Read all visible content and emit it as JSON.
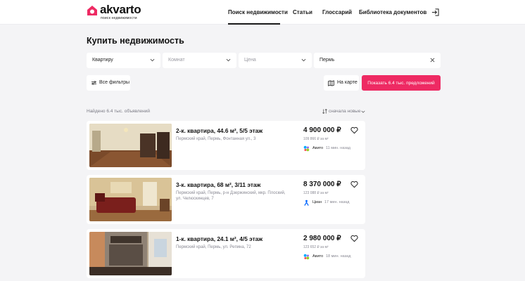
{
  "brand": {
    "name": "akvarto",
    "tagline": "поиск недвижимости",
    "accent": "#ee2a63"
  },
  "nav": {
    "items": [
      {
        "label": "Поиск недвижимости",
        "active": true
      },
      {
        "label": "Статьи",
        "active": false
      },
      {
        "label": "Глоссарий",
        "active": false
      },
      {
        "label": "Библиотека документов",
        "active": false
      }
    ],
    "login_icon": "login-icon"
  },
  "page": {
    "title": "Купить недвижимость"
  },
  "filters": {
    "type": {
      "value": "Квартиру"
    },
    "rooms": {
      "placeholder": "Комнат"
    },
    "price": {
      "placeholder": "Цена"
    },
    "city": {
      "value": "Пермь"
    },
    "all_filters_label": "Все фильтры",
    "map_label": "На карте",
    "show_label": "Показать 6.4 тыс. предложений"
  },
  "results": {
    "found_text": "Найдено 6.4 тыс. объявлений",
    "sort_label": "сначала новые"
  },
  "listings": [
    {
      "title": "2-к. квартира, 44.6 м², 5/5 этаж",
      "address": "Пермский край, Пермь, Фонтанная ул., 3",
      "price": "4 900 000 ₽",
      "price_per_m2": "109 866 ₽ за м²",
      "source": "Авито",
      "time": "11 мин. назад",
      "source_icon": "avito-logo-icon"
    },
    {
      "title": "3-к. квартира, 68 м², 3/11 этаж",
      "address": "Пермский край, Пермь, р-н Дзержинский, мкр. Плоский, ул. Челюскинцев, 7",
      "price": "8 370 000 ₽",
      "price_per_m2": "123 088 ₽ за м²",
      "source": "Циан",
      "time": "17 мин. назад",
      "source_icon": "cian-logo-icon"
    },
    {
      "title": "1-к. квартира, 24.1 м², 4/5 этаж",
      "address": "Пермский край, Пермь, ул. Репина, 72",
      "price": "2 980 000 ₽",
      "price_per_m2": "123 652 ₽ за м²",
      "source": "Авито",
      "time": "18 мин. назад",
      "source_icon": "avito-logo-icon"
    }
  ]
}
